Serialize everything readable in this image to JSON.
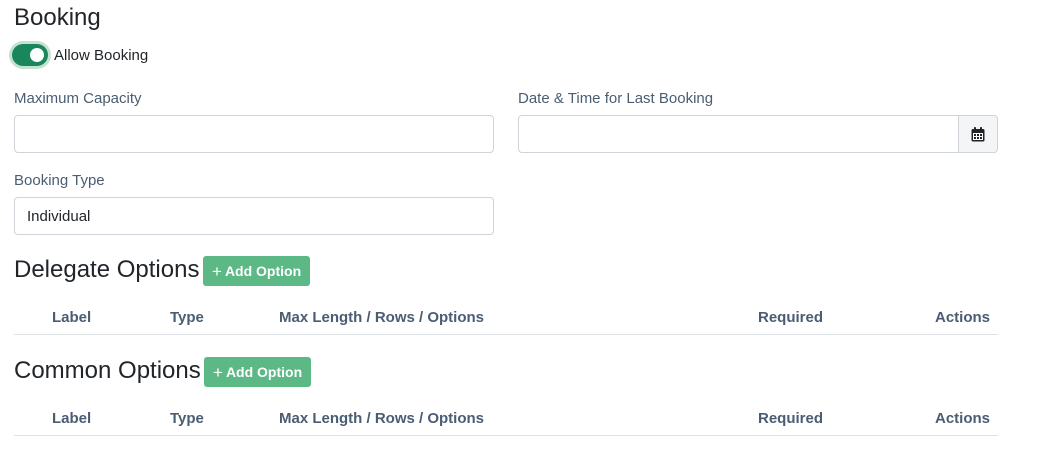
{
  "booking": {
    "title": "Booking",
    "allow_booking_label": "Allow Booking",
    "allow_booking_on": true,
    "max_capacity": {
      "label": "Maximum Capacity",
      "value": ""
    },
    "last_booking": {
      "label": "Date & Time for Last Booking",
      "value": "",
      "icon": "calendar-icon"
    },
    "booking_type": {
      "label": "Booking Type",
      "value": "Individual"
    }
  },
  "delegate_options": {
    "title": "Delegate Options",
    "add_label": "Add Option",
    "columns": [
      "Label",
      "Type",
      "Max Length / Rows / Options",
      "Required",
      "Actions"
    ]
  },
  "common_options": {
    "title": "Common Options",
    "add_label": "Add Option",
    "columns": [
      "Label",
      "Type",
      "Max Length / Rows / Options",
      "Required",
      "Actions"
    ]
  },
  "colors": {
    "toggle": "#19875b",
    "add_button": "#5cb885",
    "label_text": "#4a5d73"
  }
}
